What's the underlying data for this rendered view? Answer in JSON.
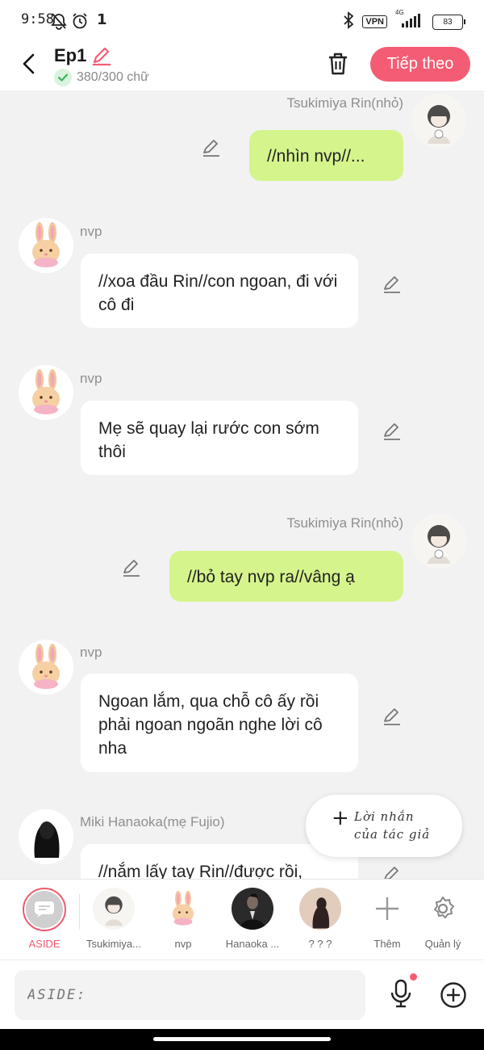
{
  "status_bar": {
    "time": "9:58",
    "notif_count": "1",
    "signal_label": "4G",
    "vpn": "VPN",
    "battery": "83",
    "icons": [
      "bell-off-icon",
      "alarm-icon",
      "bluetooth-icon",
      "signal-icon",
      "battery-icon"
    ]
  },
  "header": {
    "title": "Ep1",
    "word_count": "380/300 chữ",
    "next_button": "Tiếp theo",
    "accent_color": "#f45c74"
  },
  "messages": [
    {
      "side": "right",
      "speaker": "Tsukimiya Rin(nhỏ)",
      "text": "//nhìn nvp//...",
      "avatar": "rin"
    },
    {
      "side": "left",
      "speaker": "nvp",
      "text": "//xoa đầu Rin//con ngoan, đi với cô đi",
      "avatar": "bunny"
    },
    {
      "side": "left",
      "speaker": "nvp",
      "text": "Mẹ sẽ quay lại rước con sớm thôi",
      "avatar": "bunny"
    },
    {
      "side": "right",
      "speaker": "Tsukimiya Rin(nhỏ)",
      "text": "//bỏ tay nvp ra//vâng ạ",
      "avatar": "rin"
    },
    {
      "side": "left",
      "speaker": "nvp",
      "text": "Ngoan lắm, qua chỗ cô ấy rồi phải ngoan ngoãn nghe lời cô nha",
      "avatar": "bunny"
    },
    {
      "side": "left",
      "speaker": "Miki Hanaoka(mẹ Fujio)",
      "text": "//nắm lấy tay Rin//được rồi,",
      "avatar": "silhouette"
    }
  ],
  "author_note": {
    "line1": "Lời nhắn",
    "line2": "của tác giả"
  },
  "characters": [
    {
      "label": "ASIDE",
      "type": "aside",
      "active": true
    },
    {
      "label": "Tsukimiya...",
      "type": "rin"
    },
    {
      "label": "nvp",
      "type": "bunny"
    },
    {
      "label": "Hanaoka ...",
      "type": "dark"
    },
    {
      "label": "? ? ?",
      "type": "silhouette"
    },
    {
      "label": "Thêm",
      "type": "add"
    },
    {
      "label": "Quản lý",
      "type": "settings"
    }
  ],
  "input": {
    "placeholder": "ASIDE:"
  },
  "colors": {
    "green_bubble": "#d5f48c",
    "white_bubble": "#ffffff",
    "background": "#f2f2f2"
  }
}
